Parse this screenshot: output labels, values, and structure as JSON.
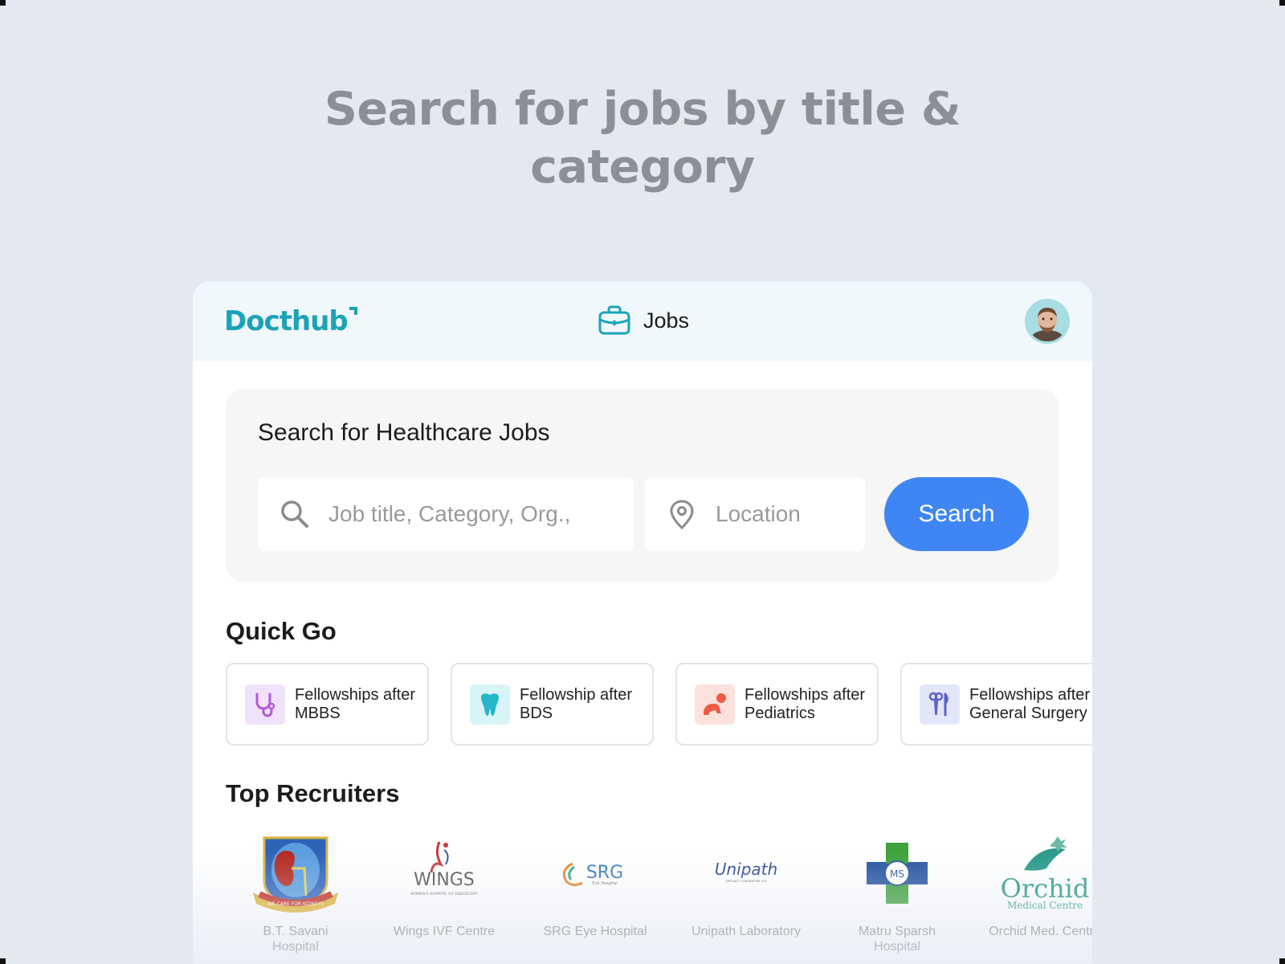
{
  "hero": {
    "line1": "Search for jobs by title &",
    "line2": "category"
  },
  "header": {
    "logo_text": "Docthub",
    "nav_label": "Jobs"
  },
  "search": {
    "heading": "Search for Healthcare Jobs",
    "job_placeholder": "Job title, Category, Org.,",
    "location_placeholder": "Location",
    "button_label": "Search"
  },
  "quick_go": {
    "title": "Quick Go",
    "items": [
      {
        "label": "Fellowships after MBBS",
        "icon": "stethoscope-icon",
        "bg": "#f1e2fb",
        "color": "#b45ad8"
      },
      {
        "label": "Fellowship after BDS",
        "icon": "tooth-icon",
        "bg": "#d8f4f6",
        "color": "#25b7c8"
      },
      {
        "label": "Fellowships after Pediatrics",
        "icon": "baby-crawling-icon",
        "bg": "#fde1dc",
        "color": "#ee5a43"
      },
      {
        "label": "Fellowships after General Surgery",
        "icon": "surgical-tools-icon",
        "bg": "#e3e5f8",
        "color": "#5a63c9"
      }
    ]
  },
  "top_recruiters": {
    "title": "Top Recruiters",
    "items": [
      {
        "name": "B.T. Savani Hospital",
        "logo": "kidney-shield-logo",
        "logo_text": "WE CARE FOR KIDNEYS"
      },
      {
        "name": "Wings IVF Centre",
        "logo": "wings-logo",
        "logo_text": "WINGS",
        "logo_subtext": "WOMEN'S HOSPITAL IVF ENDOSCOPY"
      },
      {
        "name": "SRG Eye Hospital",
        "logo": "srg-logo",
        "logo_text": "SRG",
        "logo_subtext": "Eye Hospital"
      },
      {
        "name": "Unipath Laboratory",
        "logo": "unipath-logo",
        "logo_text": "Unipath",
        "logo_subtext": "SPECIALTY LABORATORY LTD"
      },
      {
        "name": "Matru Sparsh Hospital",
        "logo": "cross-logo",
        "logo_text": "MS"
      },
      {
        "name": "Orchid Med. Centre",
        "logo": "orchid-logo",
        "logo_text": "Orchid",
        "logo_subtext": "Medical Centre"
      }
    ]
  },
  "colors": {
    "background": "#e3e8f1",
    "brand_teal": "#1aa3b8",
    "search_button": "#3f86f4"
  }
}
